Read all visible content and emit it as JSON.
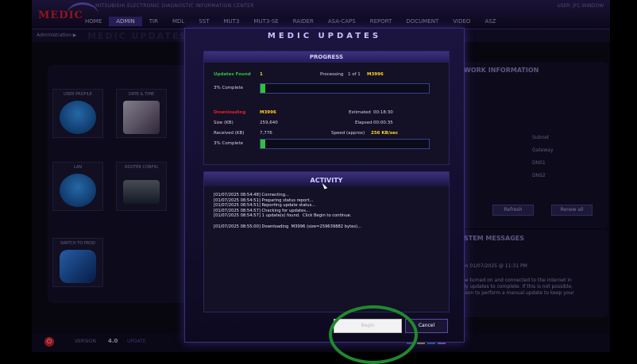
{
  "app": {
    "logo": "MEDIC",
    "title": "MITSUBISHI ELECTRONIC DIAGNOSTIC INFORMATION CENTER",
    "user_info": "USER: JFC   WINDOW",
    "breadcrumb": "Administration  ▶",
    "shadow_text": "MEDIC UPDATES"
  },
  "nav": {
    "items": [
      {
        "label": "HOME"
      },
      {
        "label": "ADMIN",
        "active": true
      },
      {
        "label": "TIR"
      },
      {
        "label": "MDL"
      },
      {
        "label": "SST"
      },
      {
        "label": "MUT3"
      },
      {
        "label": "MUT3-SE"
      },
      {
        "label": "RAIDER"
      },
      {
        "label": "ASA-CAPS"
      },
      {
        "label": "REPORT"
      },
      {
        "label": "DOCUMENT"
      },
      {
        "label": "VIDEO"
      },
      {
        "label": "ASZ"
      }
    ]
  },
  "tiles": {
    "user_profile": "USER PROFILE",
    "date_time": "DATE & TIME",
    "lan": "LAN",
    "router_config": "ROUTER CONFIG",
    "switch_to_prod": "SWITCH TO PROD"
  },
  "right_panel": {
    "title": "WORK INFORMATION",
    "subnet": "Subnet",
    "gateway": "Gateway",
    "dns1": "DNS1",
    "dns2": "DNS2",
    "refresh": "Refresh",
    "renew_all": "Renew all",
    "messages_title": "STEM MESSAGES",
    "msg_date": "on 01/07/2025 @ 11:31 PM",
    "msg_body_1": "be turned on and connected to the internet in",
    "msg_body_2": "tly updates to complete. If this is not possible,",
    "msg_body_3": "ason to perform a manual update to keep your"
  },
  "status_bar": {
    "version_label": "VERSION",
    "version_value": "4.0",
    "update_label": "UPDATE"
  },
  "modal": {
    "title": "MEDIC UPDATES",
    "progress_header": "PROGRESS",
    "updates_found_label": "Updates Found",
    "updates_found_value": "1",
    "processing_label": "Processing",
    "processing_value": "1 of 1",
    "processing_item": "M3996",
    "overall_percent_label": "3% Complete",
    "overall_percent": 3,
    "downloading_label": "Downloading",
    "downloading_item": "M3996",
    "estimated_label": "Estimated",
    "estimated_value": "00:18:30",
    "size_label": "Size (KB)",
    "size_value": "259,640",
    "elapsed_label": "Elapsed",
    "elapsed_value": "00:00:35",
    "received_label": "Received (KB)",
    "received_value": "7,776",
    "speed_label": "Speed (approx)",
    "speed_value": "256 KB/sec",
    "download_percent_label": "3% Complete",
    "download_percent": 3,
    "activity_header": "ACTIVITY",
    "activity_log": "[01/07/2025 08:54:48] Connecting...\n[01/07/2025 08:54:51] Preparing status report...\n[01/07/2025 08:54:51] Reporting update status...\n[01/07/2025 08:54:57] Checking for updates...\n[01/07/2025 08:54:57] 1 update(s) found.  Click Begin to continue.\n\n[01/07/2025 08:55:00] Downloading  M3996 (size=259639882 bytes)...",
    "begin_button": "Begin",
    "cancel_button": "Cancel"
  },
  "colors": {
    "accent": "#3a2d85",
    "success": "#2ec23b",
    "warning": "#ffd21f",
    "error": "#e0212c",
    "annotation": "#1f8a2c"
  }
}
